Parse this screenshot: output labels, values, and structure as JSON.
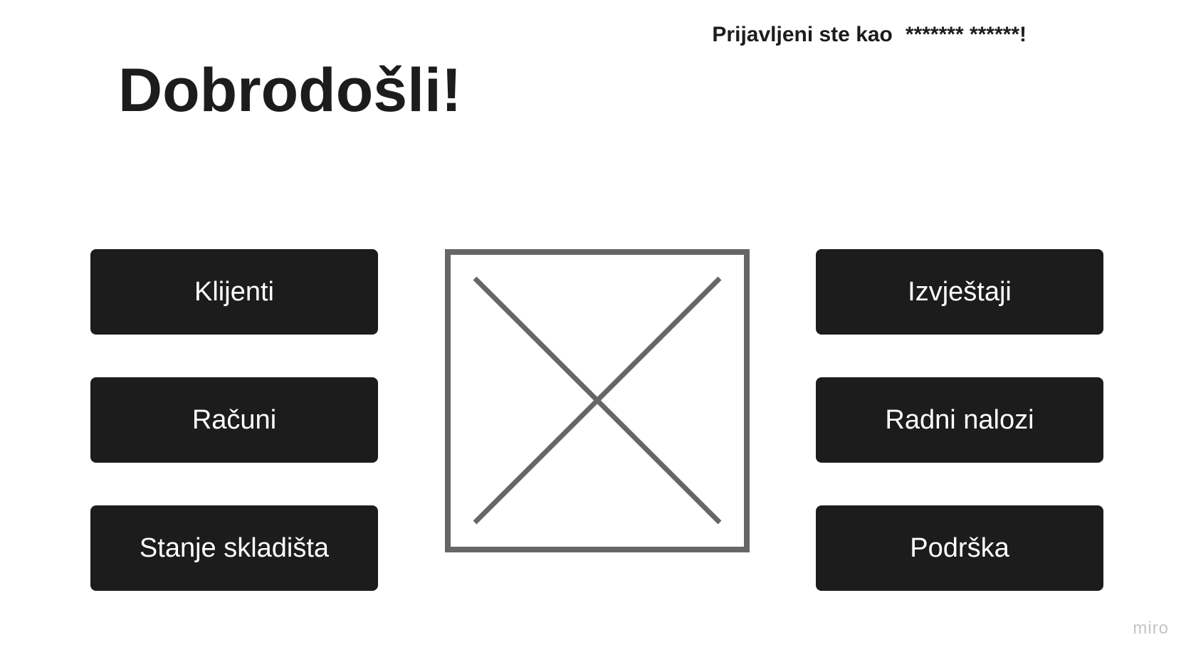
{
  "header": {
    "login_prefix": "Prijavljeni ste kao",
    "user_name": "******* ******!",
    "title": "Dobrodošli!"
  },
  "nav": {
    "left": [
      {
        "label": "Klijenti"
      },
      {
        "label": "Računi"
      },
      {
        "label": "Stanje skladišta"
      }
    ],
    "right": [
      {
        "label": "Izvještaji"
      },
      {
        "label": "Radni nalozi"
      },
      {
        "label": "Podrška"
      }
    ]
  },
  "placeholder": {
    "icon": "image-placeholder-icon"
  },
  "watermark": {
    "text": "miro"
  },
  "colors": {
    "button_bg": "#1c1c1c",
    "button_text": "#ffffff",
    "placeholder_stroke": "#666666",
    "watermark": "#c4c4c8"
  }
}
